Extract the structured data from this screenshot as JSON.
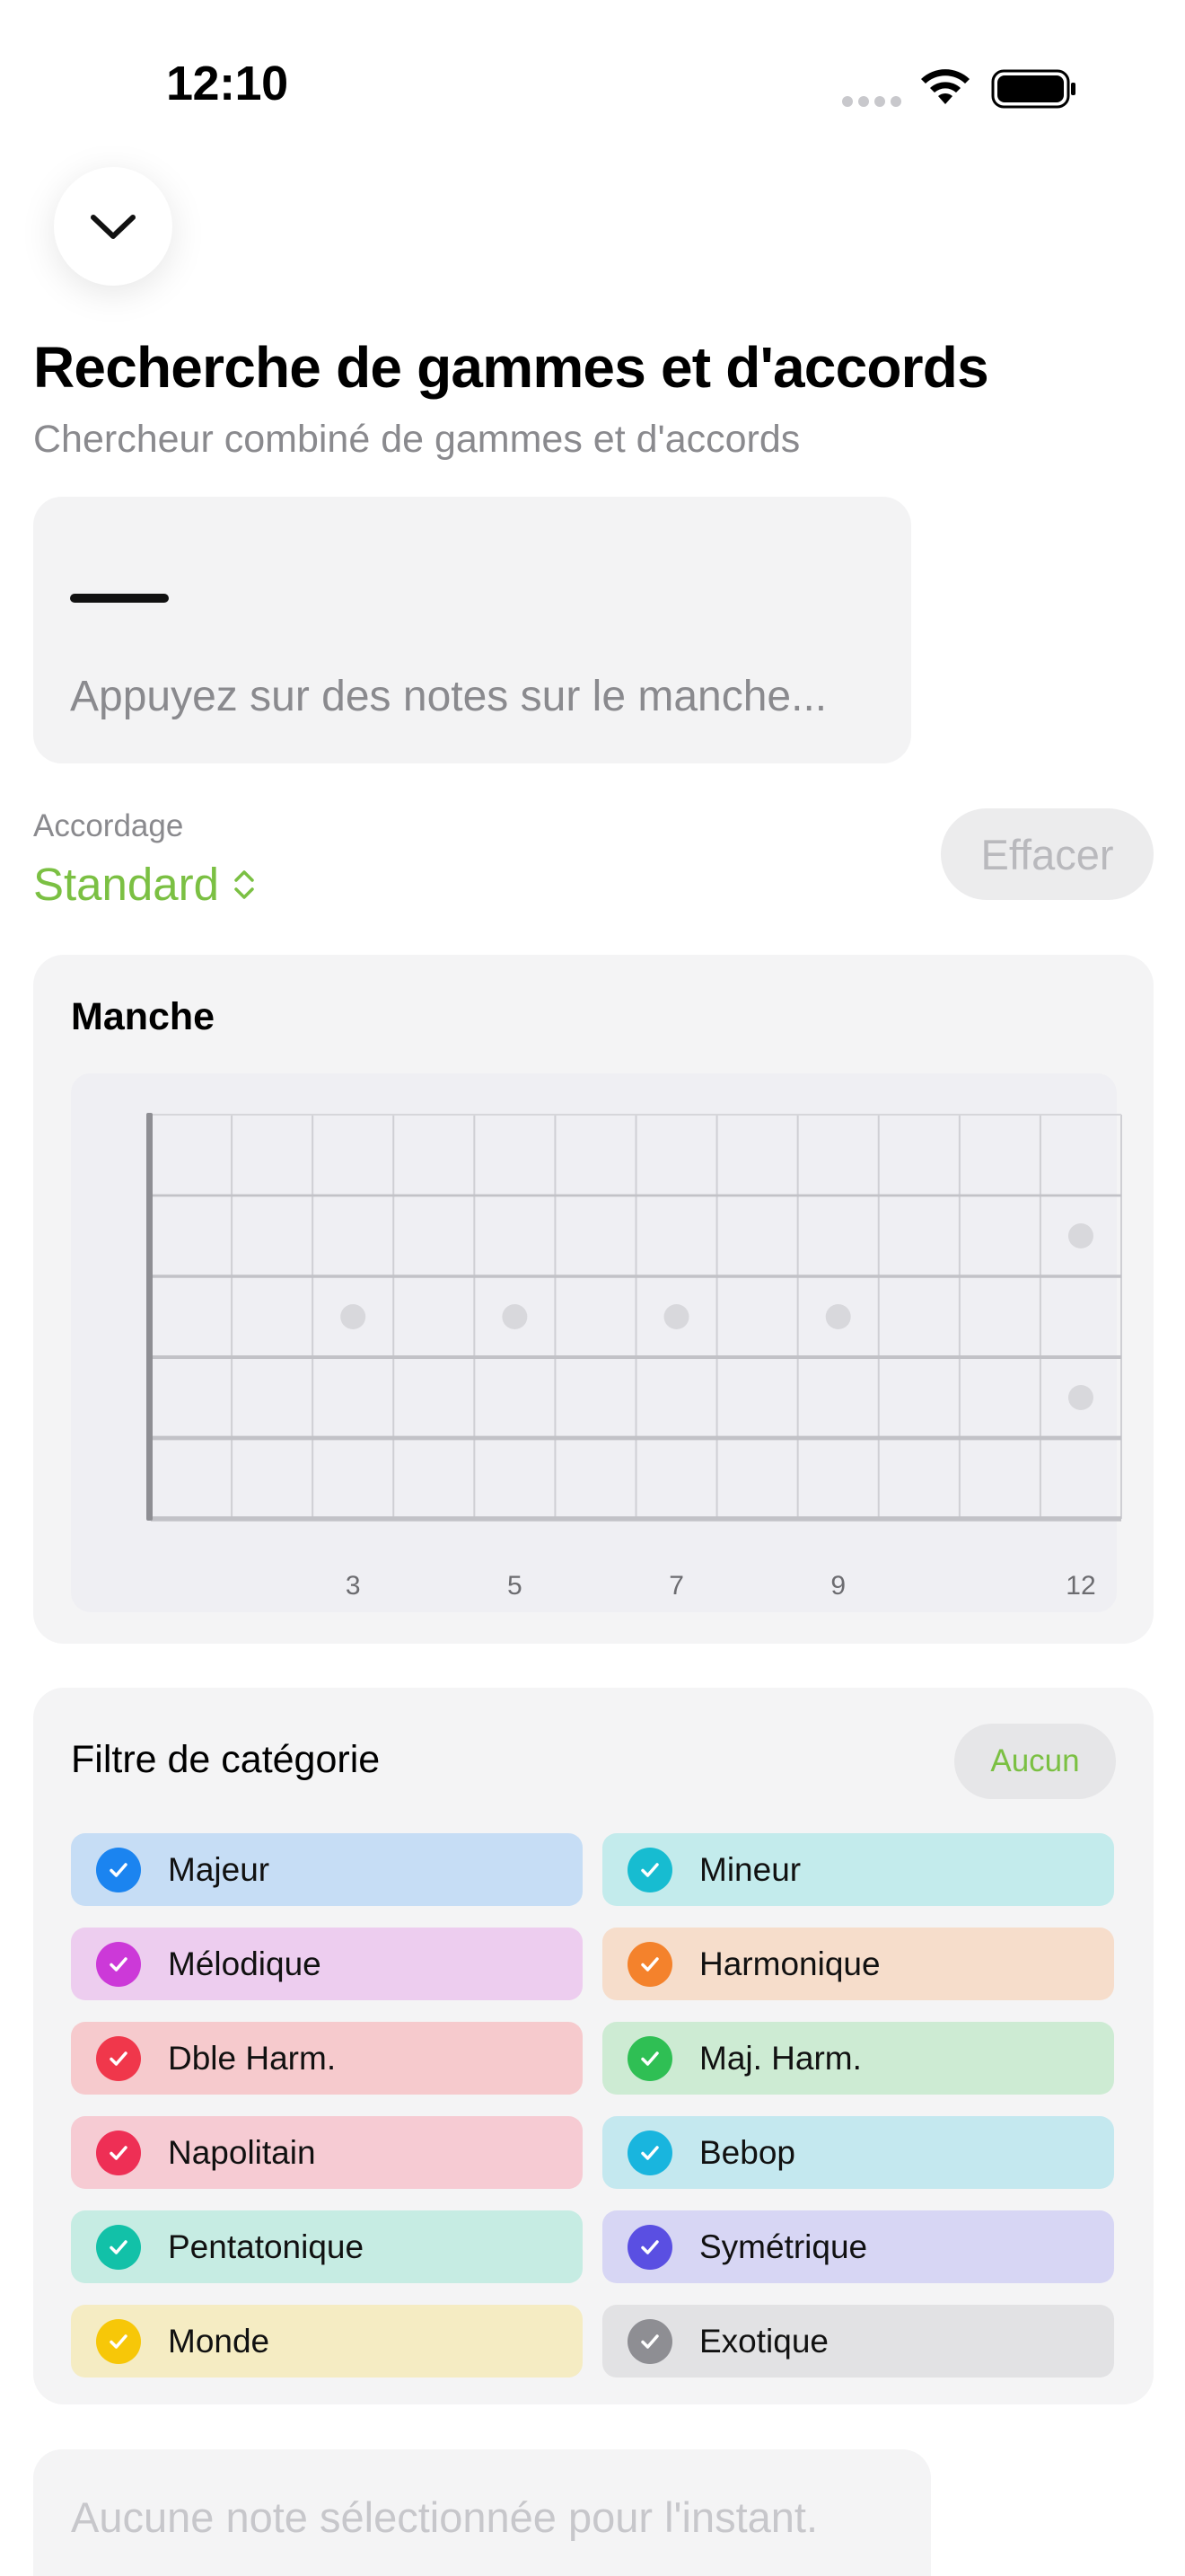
{
  "status_bar": {
    "time": "12:10",
    "icons": [
      "signal-icon",
      "wifi-icon",
      "battery-icon"
    ]
  },
  "header": {
    "dismiss_icon": "chevron-down-icon",
    "title": "Recherche de gammes et d'accords",
    "subtitle": "Chercheur combiné de gammes et d'accords"
  },
  "notes": {
    "hint": "Appuyez sur des notes sur le manche..."
  },
  "tuning": {
    "label": "Accordage",
    "value": "Standard",
    "icon": "chevron-up-down-icon"
  },
  "clear_button": "Effacer",
  "neck": {
    "title": "Manche",
    "frets_shown": 12,
    "strings": 6,
    "fret_numbers": [
      "3",
      "5",
      "7",
      "9",
      "12"
    ]
  },
  "category_filter": {
    "title": "Filtre de catégorie",
    "none_button": "Aucun",
    "categories": [
      {
        "label": "Majeur",
        "color": "#1b84f0",
        "bg": "#c6ddf5",
        "checked": true
      },
      {
        "label": "Mineur",
        "color": "#17bcd1",
        "bg": "#c3ebec",
        "checked": true
      },
      {
        "label": "Mélodique",
        "color": "#cc39d8",
        "bg": "#edcdef",
        "checked": true
      },
      {
        "label": "Harmonique",
        "color": "#f4822c",
        "bg": "#f6ddcb",
        "checked": true
      },
      {
        "label": "Dble Harm.",
        "color": "#f0374b",
        "bg": "#f6cacd",
        "checked": true
      },
      {
        "label": "Maj. Harm.",
        "color": "#2fbf54",
        "bg": "#cdebd3",
        "checked": true
      },
      {
        "label": "Napolitain",
        "color": "#ee2f55",
        "bg": "#f6cbd3",
        "checked": true
      },
      {
        "label": "Bebop",
        "color": "#19b5de",
        "bg": "#c4e8ef",
        "checked": true
      },
      {
        "label": "Pentatonique",
        "color": "#12c1a8",
        "bg": "#c6ece3",
        "checked": true
      },
      {
        "label": "Symétrique",
        "color": "#5a4fe2",
        "bg": "#d7d6f4",
        "checked": true
      },
      {
        "label": "Monde",
        "color": "#f7c708",
        "bg": "#f5ecc3",
        "checked": true
      },
      {
        "label": "Exotique",
        "color": "#8e8e93",
        "bg": "#e2e2e4",
        "checked": true
      }
    ]
  },
  "result": {
    "empty_text": "Aucune note sélectionnée pour l'instant."
  },
  "colors": {
    "accent": "#7bc043",
    "secondary_text": "#8a8a8e"
  }
}
